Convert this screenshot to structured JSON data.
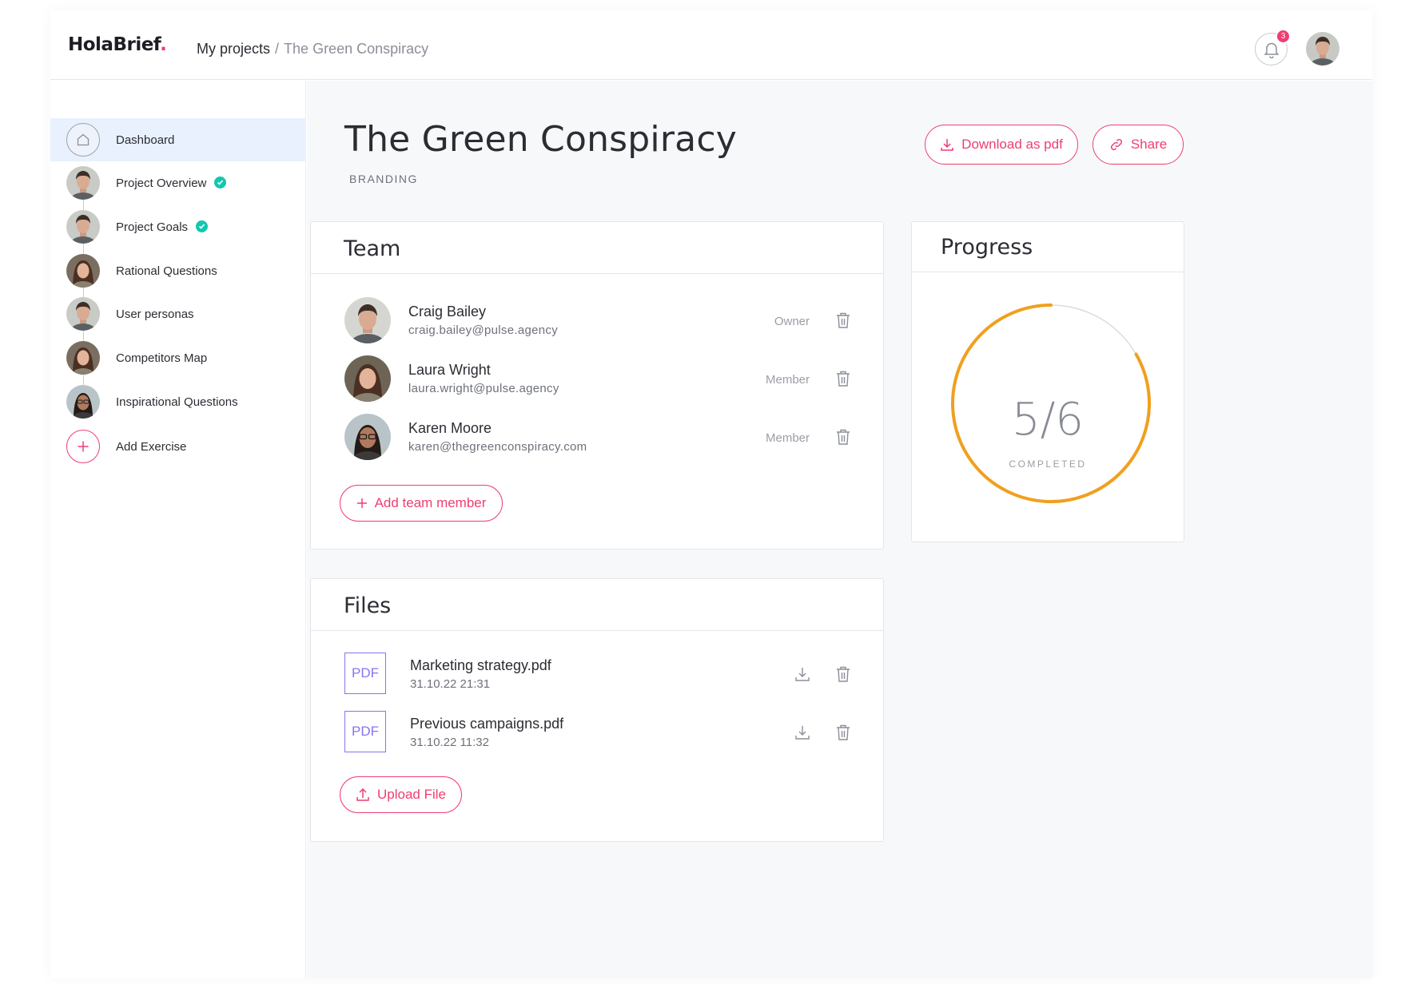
{
  "app": {
    "logo_text": "HolaBrief",
    "logo_dot": ".",
    "accent_color": "#ee3e71",
    "check_color": "#12c7b0"
  },
  "header": {
    "breadcrumb": {
      "root": "My projects",
      "separator": "/",
      "current": "The Green Conspiracy"
    },
    "notifications": {
      "count": "3",
      "icon": "bell-icon"
    },
    "user_avatar": "avatar"
  },
  "sidebar": {
    "items": [
      {
        "label": "Dashboard",
        "icon": "home-icon",
        "active": true,
        "completed": false
      },
      {
        "label": "Project Overview",
        "icon": "avatar",
        "completed": true
      },
      {
        "label": "Project Goals",
        "icon": "avatar",
        "completed": true
      },
      {
        "label": "Rational Questions",
        "icon": "avatar",
        "completed": false
      },
      {
        "label": "User personas",
        "icon": "avatar",
        "completed": false
      },
      {
        "label": "Competitors Map",
        "icon": "avatar",
        "completed": false
      },
      {
        "label": "Inspirational Questions",
        "icon": "avatar",
        "completed": false
      },
      {
        "label": "Add Exercise",
        "icon": "plus-icon",
        "completed": false
      }
    ]
  },
  "page": {
    "title": "The Green Conspiracy",
    "subtitle": "BRANDING",
    "download_label": "Download as pdf",
    "share_label": "Share"
  },
  "team": {
    "title": "Team",
    "members": [
      {
        "name": "Craig Bailey",
        "email": "craig.bailey@pulse.agency",
        "role": "Owner"
      },
      {
        "name": "Laura Wright",
        "email": "laura.wright@pulse.agency",
        "role": "Member"
      },
      {
        "name": "Karen Moore",
        "email": "karen@thegreenconspiracy.com",
        "role": "Member"
      }
    ],
    "add_label": "Add team member"
  },
  "files": {
    "title": "Files",
    "items": [
      {
        "type": "PDF",
        "name": "Marketing strategy.pdf",
        "date": "31.10.22 21:31"
      },
      {
        "type": "PDF",
        "name": "Previous campaigns.pdf",
        "date": "31.10.22 11:32"
      }
    ],
    "upload_label": "Upload File"
  },
  "progress": {
    "title": "Progress",
    "completed": 5,
    "total": 6,
    "value_text": "5/6",
    "caption": "COMPLETED",
    "ring_color": "#f0a01e"
  }
}
